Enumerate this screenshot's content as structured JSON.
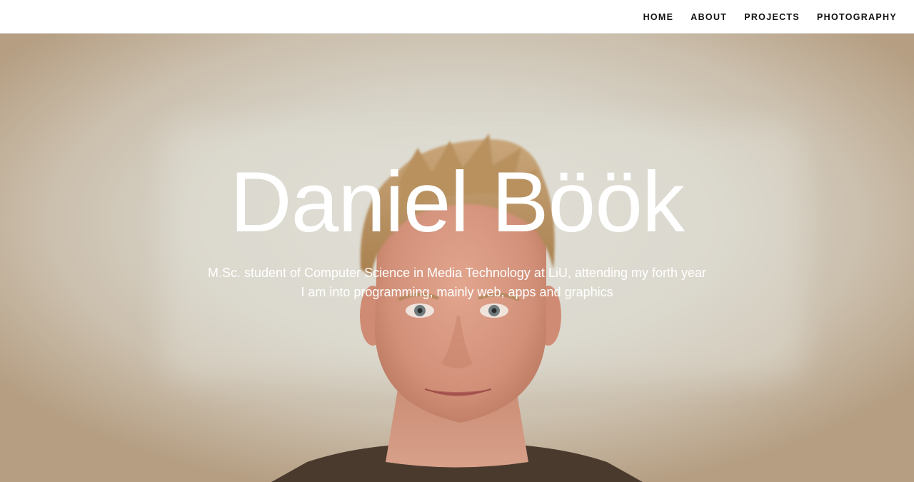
{
  "nav": {
    "items": [
      {
        "label": "HOME"
      },
      {
        "label": "ABOUT"
      },
      {
        "label": "PROJECTS"
      },
      {
        "label": "PHOTOGRAPHY"
      }
    ]
  },
  "hero": {
    "name": "Daniel Böök",
    "subtitle_line1": "M.Sc. student of Computer Science in Media Technology at LiU, attending my forth year",
    "subtitle_line2": "I am into programming, mainly web, apps and graphics"
  },
  "colors": {
    "nav_background": "#ffffff",
    "nav_text": "#111111",
    "hero_text": "#ffffff",
    "hero_background": "#d7d3c7"
  }
}
